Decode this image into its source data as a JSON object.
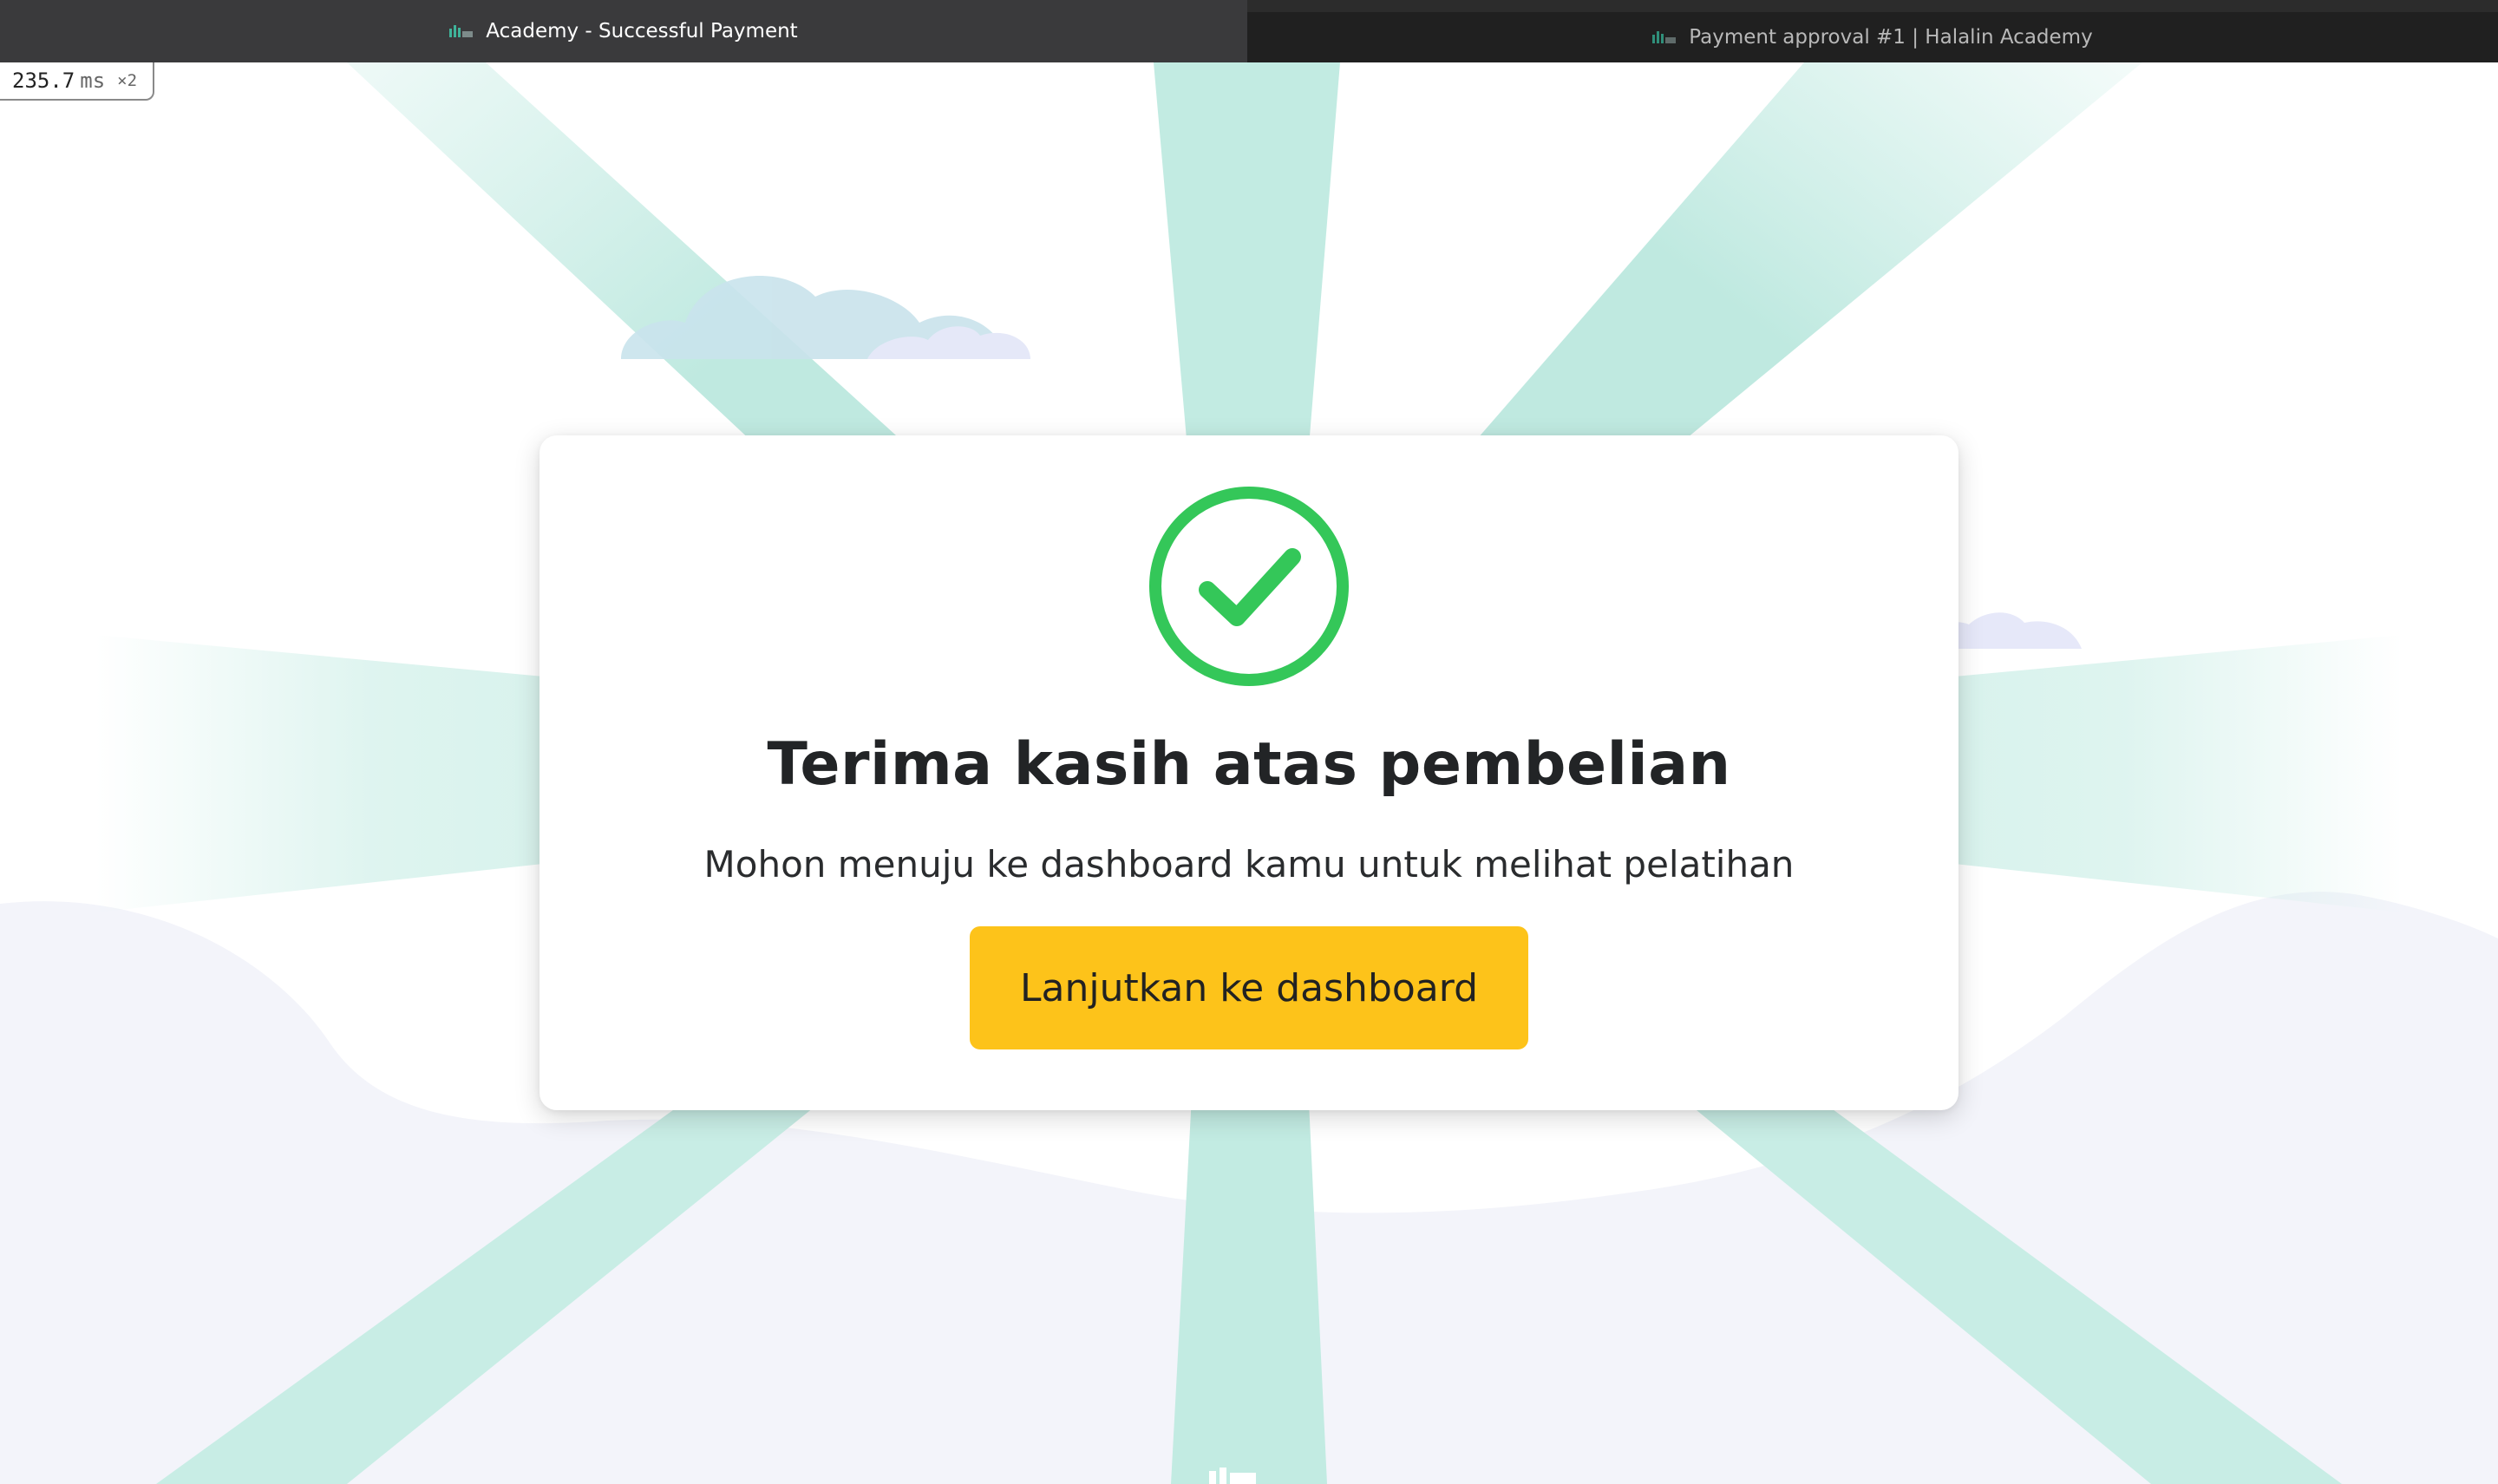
{
  "browser": {
    "tabs": [
      {
        "title": "Academy - Successful Payment",
        "active": true,
        "favicon": "halalin-logo-icon"
      },
      {
        "title": "Payment approval #1 | Halalin Academy",
        "active": false,
        "favicon": "halalin-logo-icon"
      }
    ]
  },
  "perf_badge": {
    "value": "235.7",
    "unit": "ms",
    "multiplier": "×2"
  },
  "modal": {
    "icon": "check-circle-icon",
    "title": "Terima kasih atas pembelian",
    "message": "Mohon menuju ke dashboard kamu untuk melihat pelatihan",
    "button_label": "Lanjutkan ke dashboard"
  },
  "colors": {
    "accent_green": "#34c759",
    "button_yellow": "#fdc31a",
    "ray_teal": "#bfe9e0",
    "cloud_lavender": "#e9ecfa",
    "tab_active": "#3a3a3c",
    "tab_inactive": "#202020"
  }
}
